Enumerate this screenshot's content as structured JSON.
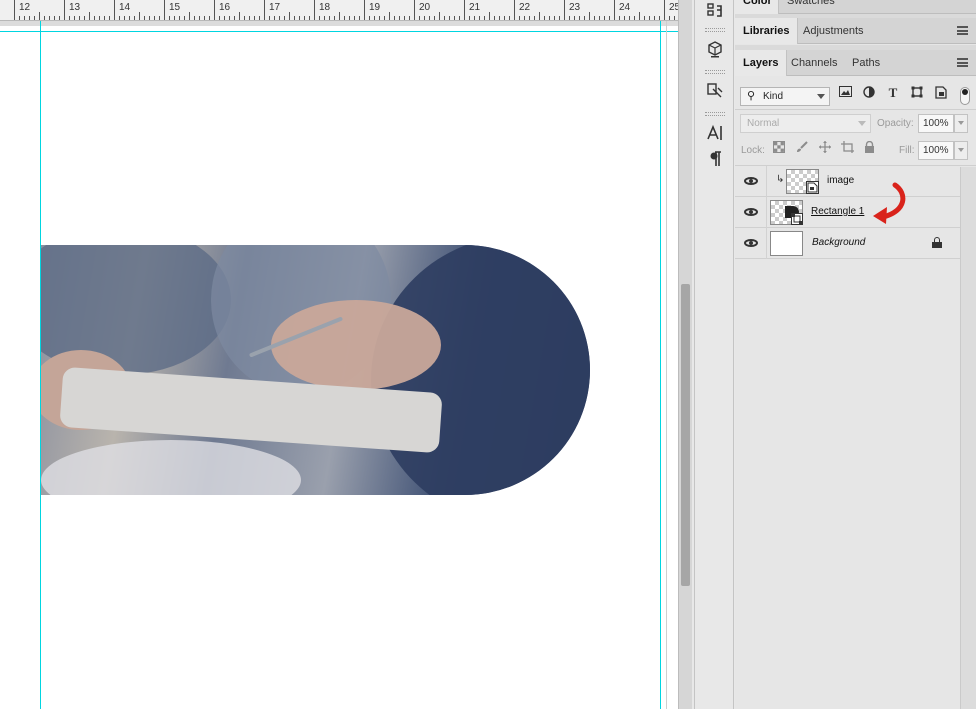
{
  "ruler": {
    "labels": [
      "12",
      "13",
      "14",
      "15",
      "16",
      "17",
      "18",
      "19",
      "20",
      "21",
      "22",
      "23",
      "24",
      "25"
    ]
  },
  "tabs_top": [
    "Color",
    "Swatches"
  ],
  "tabs_mid": [
    "Libraries",
    "Adjustments"
  ],
  "tabs_layers": [
    "Layers",
    "Channels",
    "Paths"
  ],
  "filter": {
    "kind_label": "Kind"
  },
  "blend": {
    "mode": "Normal",
    "opacity_label": "Opacity:",
    "opacity_value": "100%"
  },
  "lockrow": {
    "lock_label": "Lock:",
    "fill_label": "Fill:",
    "fill_value": "100%"
  },
  "layers": [
    {
      "name": "image",
      "thumb": "checker",
      "clipped": true,
      "underline": false,
      "italic": false,
      "locked": false
    },
    {
      "name": "Rectangle 1",
      "thumb": "checker",
      "clipped": false,
      "underline": true,
      "italic": false,
      "locked": false
    },
    {
      "name": "Background",
      "thumb": "white",
      "clipped": false,
      "underline": false,
      "italic": true,
      "locked": true
    }
  ],
  "colors": {
    "guide": "#00d5e0",
    "annotation_arrow": "#d9231b",
    "panel_bg": "#e6e6e6"
  },
  "icons": [
    "history-icon",
    "3d-cube-icon",
    "properties-icon",
    "character-icon",
    "paragraph-icon",
    "search-icon",
    "image-filter-icon",
    "adjustment-filter-icon",
    "type-filter-icon",
    "shape-filter-icon",
    "smart-object-filter-icon",
    "lock-transparent-icon",
    "lock-paint-icon",
    "lock-move-icon",
    "lock-artboard-icon",
    "lock-all-icon",
    "eye-icon",
    "lock-icon",
    "clip-arrow-icon",
    "red-curved-arrow-icon"
  ]
}
